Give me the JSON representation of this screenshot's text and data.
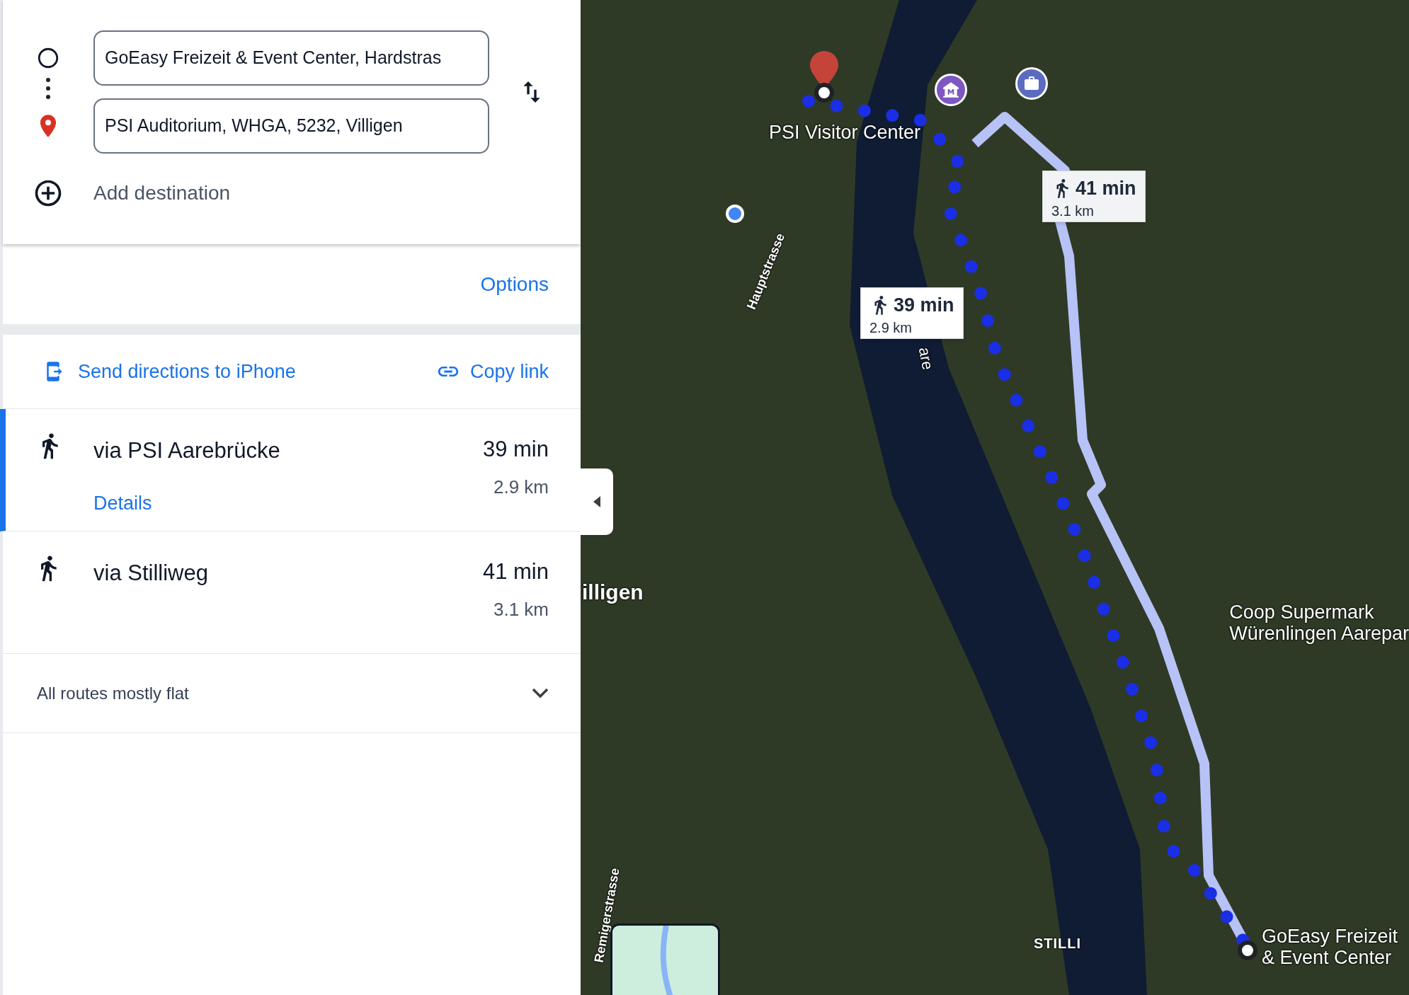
{
  "waypoints": [
    {
      "kind": "origin",
      "value": "GoEasy Freizeit & Event Center, Hardstras"
    },
    {
      "kind": "destination",
      "value": "PSI Auditorium, WHGA, 5232, Villigen"
    }
  ],
  "add_destination": "Add destination",
  "options_link": "Options",
  "share": {
    "send": "Send directions to iPhone",
    "copy": "Copy link"
  },
  "routes": [
    {
      "name": "via PSI Aarebrücke",
      "duration": "39 min",
      "distance": "2.9 km",
      "details": "Details",
      "selected": true
    },
    {
      "name": "via Stilliweg",
      "duration": "41 min",
      "distance": "3.1 km",
      "selected": false
    }
  ],
  "elevation_note": "All routes mostly flat",
  "map": {
    "route_callouts": [
      {
        "duration": "41 min",
        "distance": "3.1 km"
      },
      {
        "duration": "39 min",
        "distance": "2.9 km"
      }
    ],
    "labels": [
      {
        "kind": "place",
        "text": "PSI Visitor Center"
      },
      {
        "kind": "road",
        "text": "Hauptstrasse"
      },
      {
        "kind": "water",
        "text": "are"
      },
      {
        "kind": "town",
        "text": "illigen"
      },
      {
        "kind": "place",
        "text": "Coop Supermark\nWürenlingen Aarepar"
      },
      {
        "kind": "road",
        "text": "Remigerstrasse"
      },
      {
        "kind": "village",
        "text": "STILLI"
      },
      {
        "kind": "place",
        "text": "GoEasy Freizeit\n& Event Center"
      }
    ]
  }
}
